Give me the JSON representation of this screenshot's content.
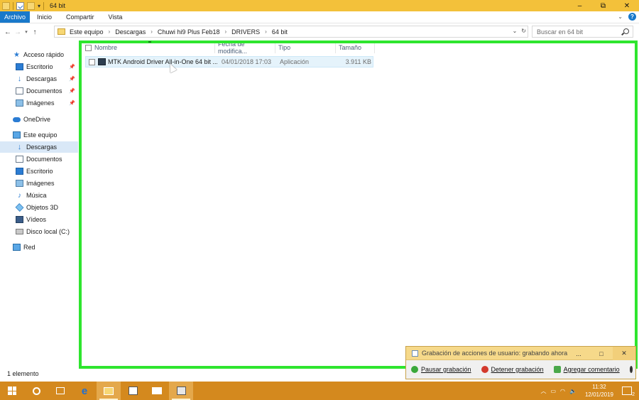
{
  "window": {
    "title": "64 bit",
    "minimize": "–",
    "maximize": "⧉",
    "close": "✕"
  },
  "ribbon": {
    "tabs": [
      {
        "label": "Archivo",
        "active": true
      },
      {
        "label": "Inicio"
      },
      {
        "label": "Compartir"
      },
      {
        "label": "Vista"
      }
    ],
    "help": "?"
  },
  "address": {
    "breadcrumb": [
      "Este equipo",
      "Descargas",
      "Chuwi hi9 Plus Feb18",
      "DRIVERS",
      "64 bit"
    ],
    "search_placeholder": "Buscar en 64 bit"
  },
  "nav_pane": {
    "quick_access": "Acceso rápido",
    "quick_items": [
      "Escritorio",
      "Descargas",
      "Documentos",
      "Imágenes"
    ],
    "onedrive": "OneDrive",
    "this_pc": "Este equipo",
    "pc_items": [
      "Descargas",
      "Documentos",
      "Escritorio",
      "Imágenes",
      "Música",
      "Objetos 3D",
      "Vídeos",
      "Disco local (C:)"
    ],
    "network": "Red"
  },
  "columns": {
    "name": "Nombre",
    "date": "Fecha de modifica...",
    "type": "Tipo",
    "size": "Tamaño"
  },
  "files": [
    {
      "name": "MTK Android Driver All-in-One 64 bit ...",
      "date": "04/01/2018 17:03",
      "type": "Aplicación",
      "size": "3.911 KB"
    }
  ],
  "status_bar": "1 elemento",
  "psr": {
    "title": "Grabación de acciones de usuario: grabando ahora",
    "minimize": "...",
    "maximize": "□",
    "close": "✕",
    "actions": [
      "Pausar grabación",
      "Detener grabación",
      "Agregar comentario"
    ]
  },
  "taskbar": {
    "time": "11:32",
    "date": "12/01/2019",
    "notification_count": "2"
  }
}
